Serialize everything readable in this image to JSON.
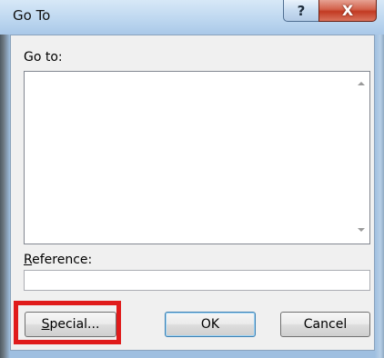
{
  "window": {
    "title": "Go To",
    "help_glyph": "?",
    "close_glyph": "X"
  },
  "goto_section": {
    "label": "Go to:",
    "items": []
  },
  "reference": {
    "label_access_key": "R",
    "label_rest": "eference:",
    "value": ""
  },
  "buttons": {
    "special_access_key": "S",
    "special_rest": "pecial...",
    "ok": "OK",
    "cancel": "Cancel"
  },
  "icons": {
    "scroll_up": "scroll-up-arrow-icon",
    "scroll_down": "scroll-down-arrow-icon",
    "help": "help-icon",
    "close": "close-icon"
  },
  "colors": {
    "annotation_highlight": "#e01b1b",
    "close_button": "#c23a22",
    "default_button_border": "#3c7fb1"
  }
}
